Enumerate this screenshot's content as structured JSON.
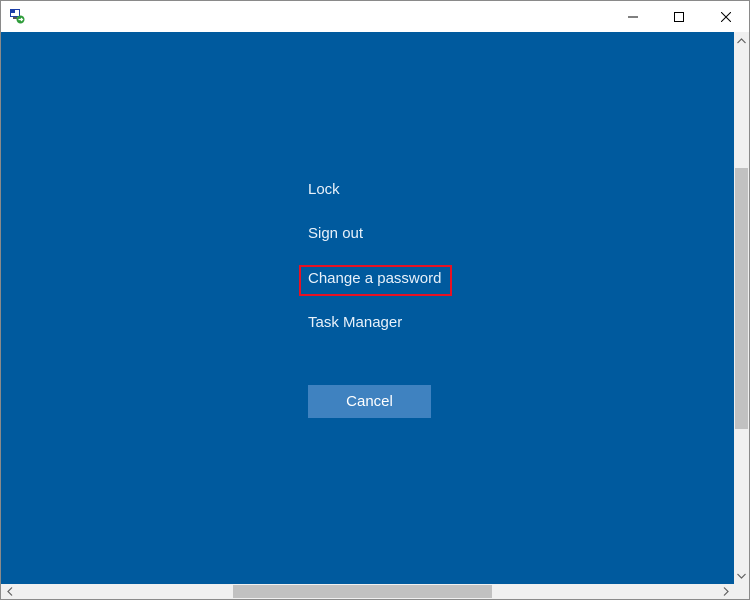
{
  "window": {
    "controls": {
      "minimize_icon": "minimize-icon",
      "maximize_icon": "maximize-icon",
      "close_icon": "close-icon"
    }
  },
  "options": {
    "lock": "Lock",
    "sign_out": "Sign out",
    "change_password": "Change a password",
    "task_manager": "Task Manager"
  },
  "cancel_label": "Cancel",
  "focused_item": "change_password",
  "colors": {
    "background": "#005a9e",
    "text": "#e8f1fa",
    "button": "#3f82c0",
    "focus_outline": "#e81123"
  },
  "scrollbars": {
    "vertical_position": 0.25,
    "horizontal_position": 0.5
  }
}
